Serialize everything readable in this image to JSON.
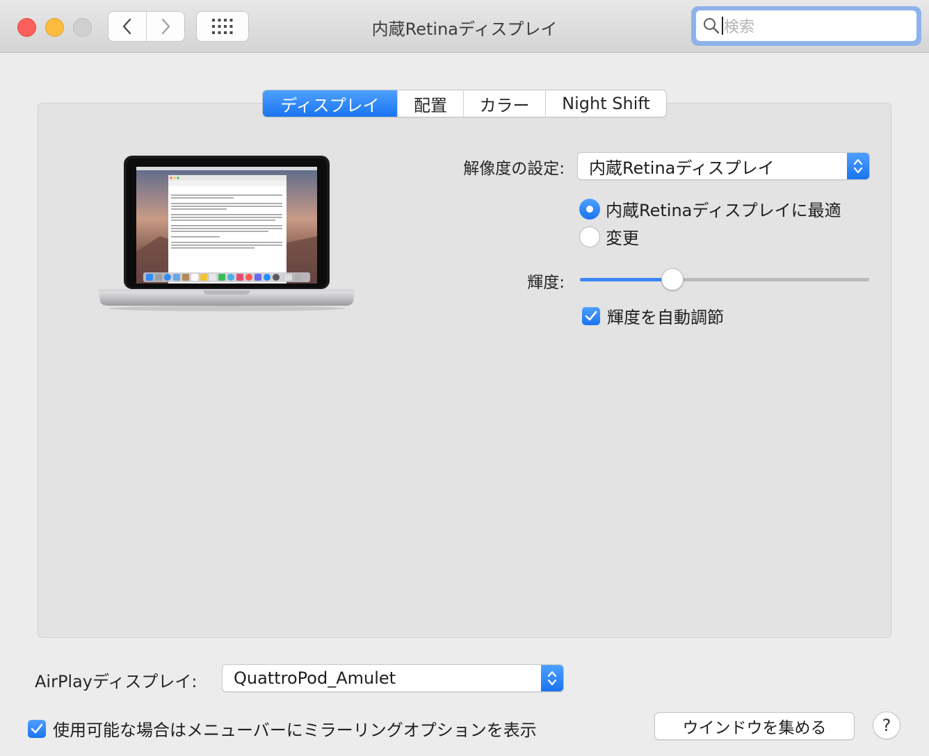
{
  "window": {
    "title": "内蔵Retinaディスプレイ"
  },
  "search": {
    "placeholder": "検索"
  },
  "tabs": [
    {
      "label": "ディスプレイ",
      "active": true
    },
    {
      "label": "配置",
      "active": false
    },
    {
      "label": "カラー",
      "active": false
    },
    {
      "label": "Night Shift",
      "active": false
    }
  ],
  "display": {
    "resolution_label": "解像度の設定:",
    "resolution_popup": "内蔵Retinaディスプレイ",
    "radio_options": [
      {
        "label": "内蔵Retinaディスプレイに最適",
        "selected": true
      },
      {
        "label": "変更",
        "selected": false
      }
    ],
    "brightness_label": "輝度:",
    "brightness_value": 0.32,
    "auto_brightness_label": "輝度を自動調節",
    "auto_brightness_checked": true
  },
  "airplay": {
    "label": "AirPlayディスプレイ:",
    "selected": "QuattroPod_Amulet",
    "mirror_option_label": "使用可能な場合はメニューバーにミラーリングオプションを表示",
    "mirror_option_checked": true
  },
  "buttons": {
    "gather_windows": "ウインドウを集める",
    "help": "?"
  },
  "colors": {
    "accent": "#1a74f0",
    "close": "#fc605c",
    "minimize": "#fdbc40"
  }
}
